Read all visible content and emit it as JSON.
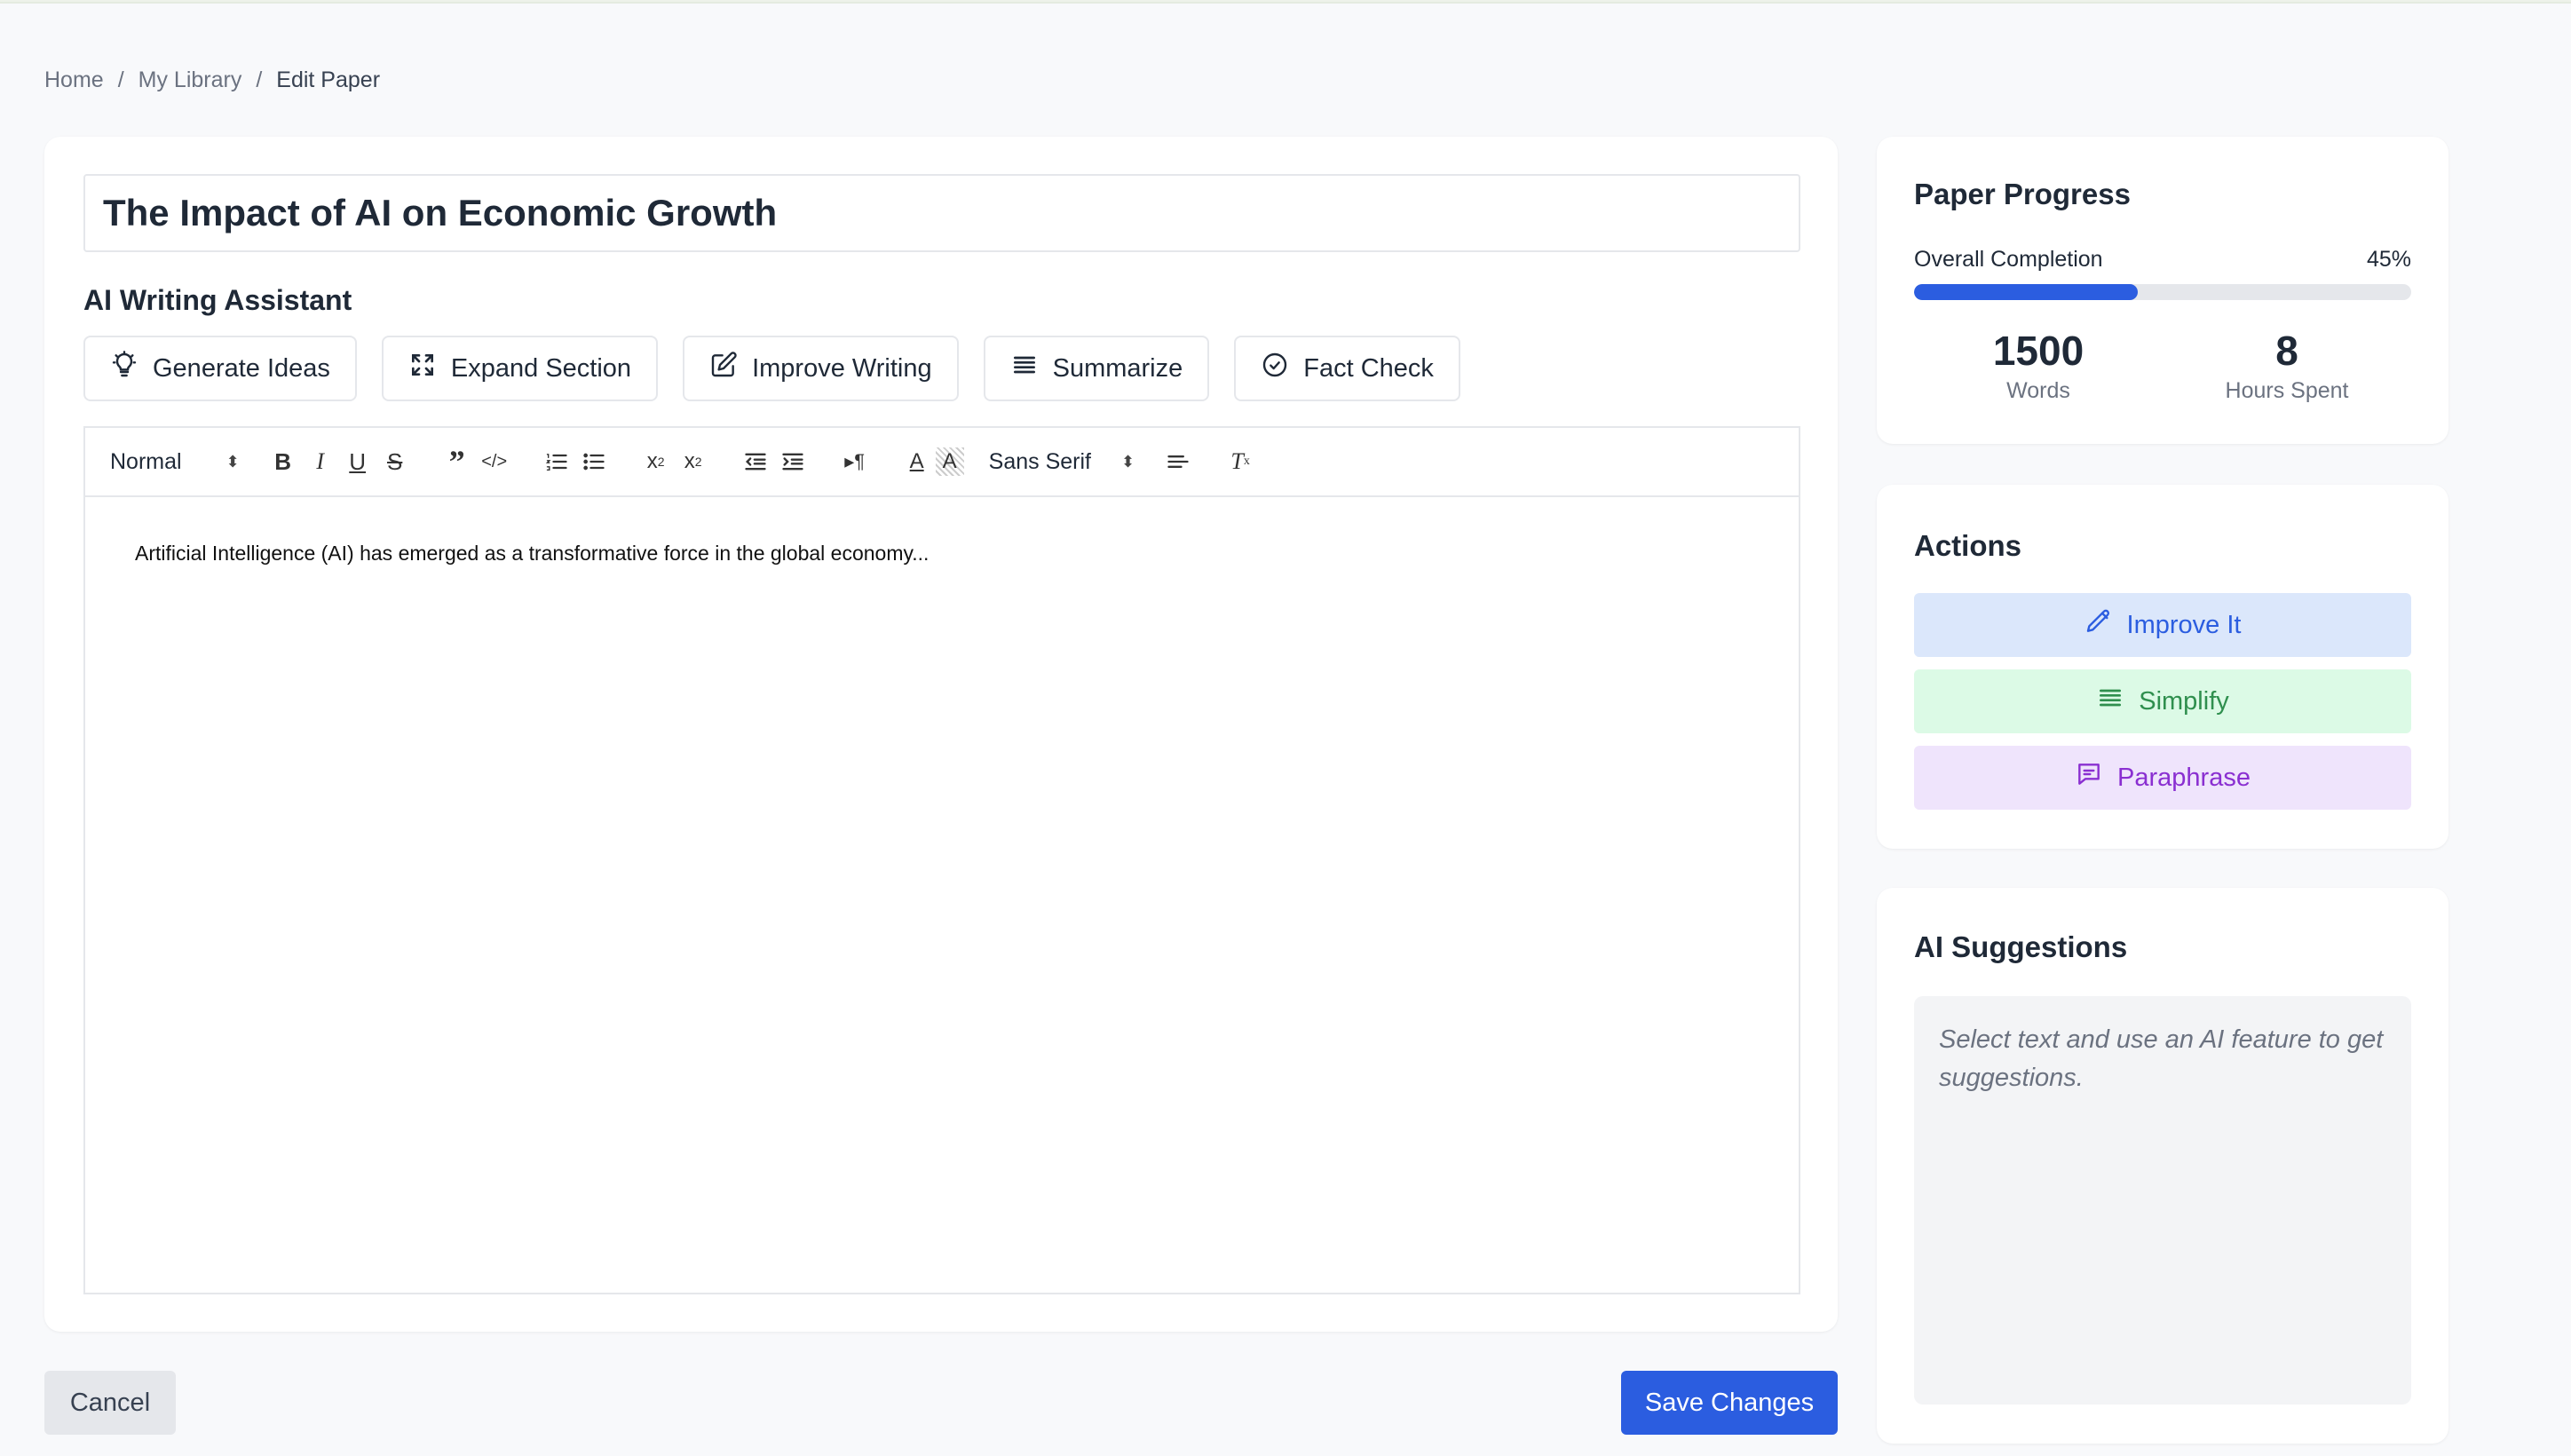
{
  "breadcrumb": {
    "home": "Home",
    "library": "My Library",
    "current": "Edit Paper",
    "separator": "/"
  },
  "paper": {
    "title": "The Impact of AI on Economic Growth"
  },
  "assistant": {
    "heading": "AI Writing Assistant",
    "buttons": [
      {
        "label": "Generate Ideas",
        "icon": "lightbulb-icon"
      },
      {
        "label": "Expand Section",
        "icon": "expand-icon"
      },
      {
        "label": "Improve Writing",
        "icon": "edit-icon"
      },
      {
        "label": "Summarize",
        "icon": "lines-icon"
      },
      {
        "label": "Fact Check",
        "icon": "check-circle-icon"
      }
    ]
  },
  "toolbar": {
    "heading_select": "Normal",
    "font_select": "Sans Serif",
    "buttons": [
      "bold",
      "italic",
      "underline",
      "strike",
      "blockquote",
      "code-block",
      "ordered-list",
      "bullet-list",
      "subscript",
      "superscript",
      "outdent",
      "indent",
      "text-direction",
      "font-color",
      "background-color",
      "align",
      "clear-format"
    ]
  },
  "editor": {
    "content": "Artificial Intelligence (AI) has emerged as a transformative force in the global economy..."
  },
  "footer": {
    "cancel_label": "Cancel",
    "save_label": "Save Changes"
  },
  "progress": {
    "title": "Paper Progress",
    "label": "Overall Completion",
    "percent_text": "45%",
    "percent": 45,
    "words_value": "1500",
    "words_label": "Words",
    "hours_value": "8",
    "hours_label": "Hours Spent"
  },
  "actions": {
    "title": "Actions",
    "improve_label": "Improve It",
    "simplify_label": "Simplify",
    "paraphrase_label": "Paraphrase"
  },
  "suggestions": {
    "title": "AI Suggestions",
    "placeholder": "Select text and use an AI feature to get suggestions."
  },
  "colors": {
    "primary": "#2b5de0",
    "improve_bg": "#dbe7fb",
    "simplify_bg": "#dcfae6",
    "simplify_fg": "#2f8f4e",
    "paraphrase_bg": "#efe4fc",
    "paraphrase_fg": "#8a2fd1"
  }
}
